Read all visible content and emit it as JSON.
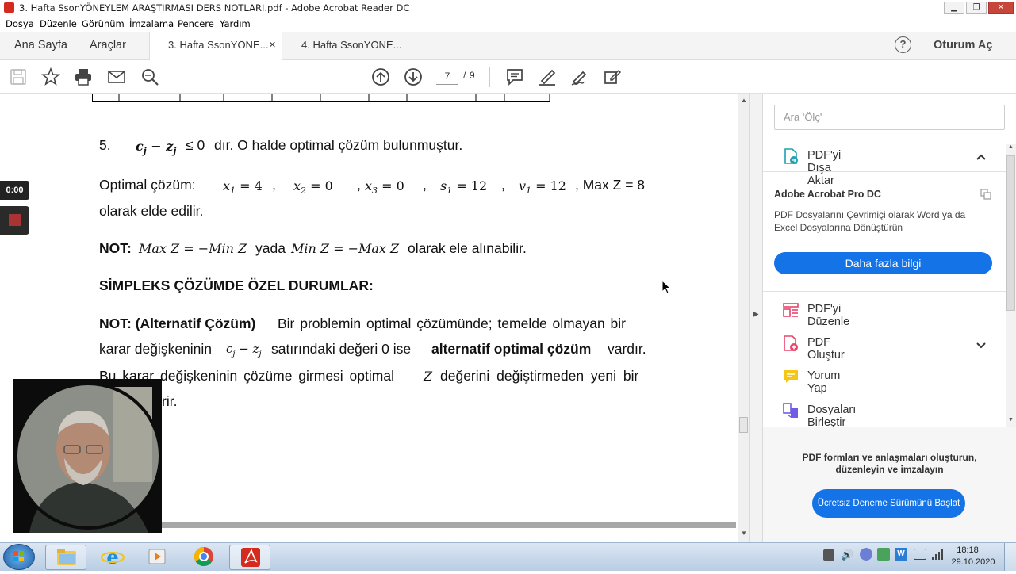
{
  "window": {
    "title": "3. Hafta SsonYÖNEYLEM ARAŞTIRMASI DERS NOTLARI.pdf - Adobe Acrobat Reader DC"
  },
  "menu": [
    "Dosya",
    "Düzenle",
    "Görünüm",
    "İmzalama",
    "Pencere",
    "Yardım"
  ],
  "tabs": {
    "home": "Ana Sayfa",
    "tools": "Araçlar",
    "doc1": "3. Hafta SsonYÖNE...",
    "doc1_close": "×",
    "doc2": "4. Hafta SsonYÖNE...",
    "help": "?",
    "signin": "Oturum Aç"
  },
  "toolbar": {
    "page_current": "7",
    "page_separator": "/",
    "page_total": "9"
  },
  "document": {
    "item5_num": "5.",
    "item5_math_a": "c",
    "item5_math_a_sub": "j",
    "item5_math_op": " − ",
    "item5_math_b": "z",
    "item5_math_b_sub": "j",
    "item5_leq": "≤ 0",
    "item5_text": "dır. O halde optimal çözüm bulunmuştur.",
    "optimal_label": "Optimal çözüm:",
    "opt_x1": "x",
    "opt_x1_sub": "1",
    "opt_x1_val": " = 4",
    "opt_x2": "x",
    "opt_x2_sub": "2",
    "opt_x2_val": " = 0",
    "opt_x3": "x",
    "opt_x3_sub": "3",
    "opt_x3_val": " = 0",
    "opt_s1": "s",
    "opt_s1_sub": "1",
    "opt_s1_val": " = 12",
    "opt_v1": "v",
    "opt_v1_sub": "1",
    "opt_v1_val": " = 12",
    "opt_maxz": ", Max Z = 8",
    "comma1": ",",
    "comma2": ",",
    "comma3": ",",
    "comma4": ",",
    "opt_line2": "olarak elde edilir.",
    "not1_label": "NOT:",
    "not1_math1": "Max Z = −Min Z",
    "not1_mid": "yada",
    "not1_math2": "Min Z = −Max Z",
    "not1_tail": "olarak ele alınabilir.",
    "heading": "SİMPLEKS ÇÖZÜMDE ÖZEL DURUMLAR:",
    "para_label": "NOT: (Alternatif Çözüm)",
    "para_l1_rest": "Bir problemin optimal çözümünde; temelde olmayan bir",
    "para_l2_a": "karar değişkeninin",
    "para_l2_math": "c",
    "para_l2_math_sub": "j",
    "para_l2_math_op": " − z",
    "para_l2_math_sub2": "j",
    "para_l2_b": "satırındaki değeri 0 ise",
    "para_l2_bold": "alternatif optimal çözüm",
    "para_l2_c": "vardır.",
    "para_l3_a": "Bu karar değişkeninin çözüme girmesi optimal",
    "para_l3_math": "Z",
    "para_l3_b": "değerini değiştirmeden yeni bir",
    "para_l4": "rir."
  },
  "rightpanel": {
    "search_placeholder": "Ara 'Ölç'",
    "export_label": "PDF'yi Dışa Aktar",
    "promo_title": "Adobe Acrobat Pro DC",
    "promo_text_1": "PDF Dosyalarını Çevrimiçi olarak Word ya da",
    "promo_text_2": "Excel Dosyalarına Dönüştürün",
    "promo_button": "Daha fazla bilgi",
    "edit_label": "PDF'yi Düzenle",
    "create_label": "PDF Oluştur",
    "comment_label": "Yorum Yap",
    "combine_label": "Dosyaları Birleştir",
    "footer_text_1": "PDF formları ve anlaşmaları oluşturun,",
    "footer_text_2": "düzenleyin ve imzalayın",
    "trial_button": "Ücretsiz Deneme Sürümünü Başlat"
  },
  "recorder": {
    "time": "0:00"
  },
  "taskbar": {
    "time": "18:18",
    "date": "29.10.2020"
  },
  "colors": {
    "accent_blue": "#1473e6",
    "acrobat_red": "#d42b1e"
  }
}
